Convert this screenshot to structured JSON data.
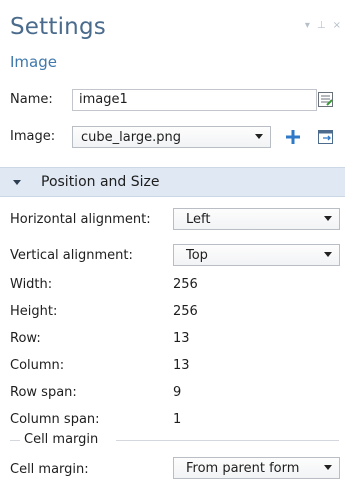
{
  "header": {
    "title": "Settings",
    "subtitle": "Image"
  },
  "window_controls": {
    "menu_glyph": "▾",
    "pin_glyph": "⊥",
    "close_glyph": "×"
  },
  "name_field": {
    "label": "Name:",
    "value": "image1"
  },
  "image_field": {
    "label": "Image:",
    "selected": "cube_large.png"
  },
  "section": {
    "label": "Position and Size"
  },
  "horizontal_alignment": {
    "label": "Horizontal alignment:",
    "selected": "Left"
  },
  "vertical_alignment": {
    "label": "Vertical alignment:",
    "selected": "Top"
  },
  "properties": {
    "width": {
      "label": "Width:",
      "value": "256"
    },
    "height": {
      "label": "Height:",
      "value": "256"
    },
    "row": {
      "label": "Row:",
      "value": "13"
    },
    "column": {
      "label": "Column:",
      "value": "13"
    },
    "row_span": {
      "label": "Row span:",
      "value": "9"
    },
    "column_span": {
      "label": "Column span:",
      "value": "1"
    }
  },
  "cell_margin_group": {
    "title": "Cell margin"
  },
  "cell_margin": {
    "label": "Cell margin:",
    "selected": "From parent form"
  },
  "colors": {
    "title": "#4a6b8c",
    "subtitle": "#3f78ac",
    "section_bg": "#dfe8f3",
    "add_icon": "#2f79c9"
  }
}
